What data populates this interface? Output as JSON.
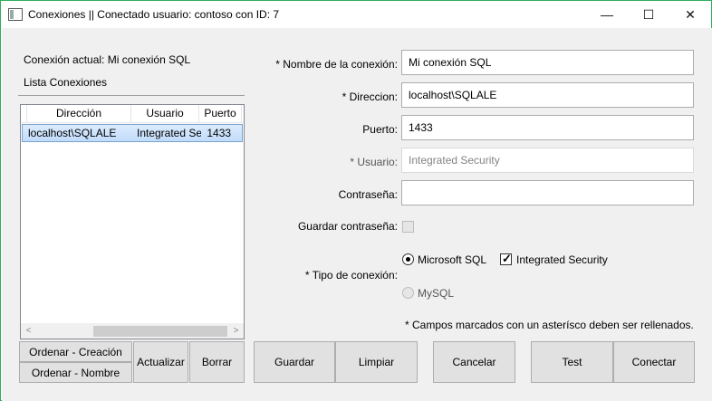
{
  "window": {
    "title": "Conexiones || Conectado usuario: contoso con ID: 7",
    "controls": {
      "minimize": "—",
      "maximize": "☐",
      "close": "✕"
    }
  },
  "left": {
    "current_connection": "Conexión actual: Mi conexión SQL",
    "list_title": "Lista Conexiones",
    "columns": [
      "Dirección",
      "Usuario",
      "Puerto"
    ],
    "rows": [
      {
        "direccion": "localhost\\SQLALE",
        "usuario": "Integrated Security",
        "puerto": "1433"
      }
    ],
    "scroll": {
      "left": "<",
      "right": ">"
    },
    "buttons": {
      "sort_creation": "Ordenar - Creación",
      "sort_name": "Ordenar - Nombre",
      "refresh": "Actualizar",
      "delete": "Borrar"
    }
  },
  "form": {
    "name_label": "* Nombre de la conexión:",
    "name_value": "Mi conexión SQL",
    "address_label": "* Direccion:",
    "address_value": "localhost\\SQLALE",
    "port_label": "Puerto:",
    "port_value": "1433",
    "user_label": "* Usuario:",
    "user_value": "Integrated Security",
    "password_label": "Contraseña:",
    "password_value": "",
    "save_password_label": "Guardar contraseña:",
    "save_password_checked": false,
    "type_label": "* Tipo de conexión:",
    "type_options": {
      "mssql": "Microsoft SQL",
      "mysql": "MySQL"
    },
    "type_selected": "Microsoft SQL",
    "integrated_security_label": "Integrated Security",
    "integrated_security_checked": true,
    "required_note": "* Campos marcados con un asterísco deben ser rellenados."
  },
  "actions": {
    "save": "Guardar",
    "clear": "Limpiar",
    "cancel": "Cancelar",
    "test": "Test",
    "connect": "Conectar"
  },
  "colors": {
    "window_border": "#2fae5a",
    "selection": "#c1dcfc",
    "button_face": "#e1e1e1"
  }
}
